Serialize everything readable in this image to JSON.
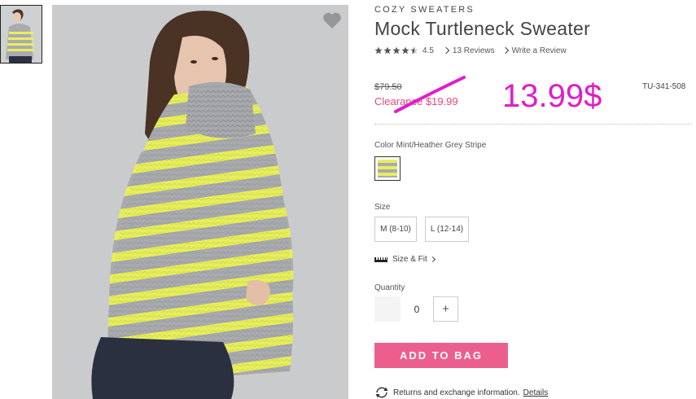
{
  "product": {
    "brand": "COZY SWEATERS",
    "title": "Mock Turtleneck Sweater",
    "rating": {
      "stars": 4.5,
      "value_label": "4.5",
      "reviews_label": "13 Reviews",
      "write_review_label": "Write a Review"
    },
    "price": {
      "original": "$79.50",
      "clearance": "Clearance $19.99",
      "handwritten_new": "13.99$"
    },
    "sku": "TU-341-508",
    "color": {
      "label": "Color Mint/Heather Grey Stripe"
    },
    "size": {
      "label": "Size",
      "options": [
        "M (8-10)",
        "L (12-14)"
      ],
      "fit_label": "Size & Fit"
    },
    "quantity": {
      "label": "Quantity",
      "value": "0",
      "plus_label": "+"
    },
    "add_to_bag_label": "ADD TO BAG",
    "returns": {
      "text": "Returns and exchange information.",
      "details_label": "Details"
    }
  },
  "colors": {
    "accent_pink": "#ec5f8d",
    "clearance_pink": "#e4487f",
    "annotation_magenta": "#e01dc8",
    "stripe_yellow": "#e8ef5e",
    "heather_grey": "#a9abaf"
  },
  "icons": [
    "heart-icon",
    "star-icon",
    "chevron-right-icon",
    "ruler-icon",
    "refresh-icon"
  ]
}
